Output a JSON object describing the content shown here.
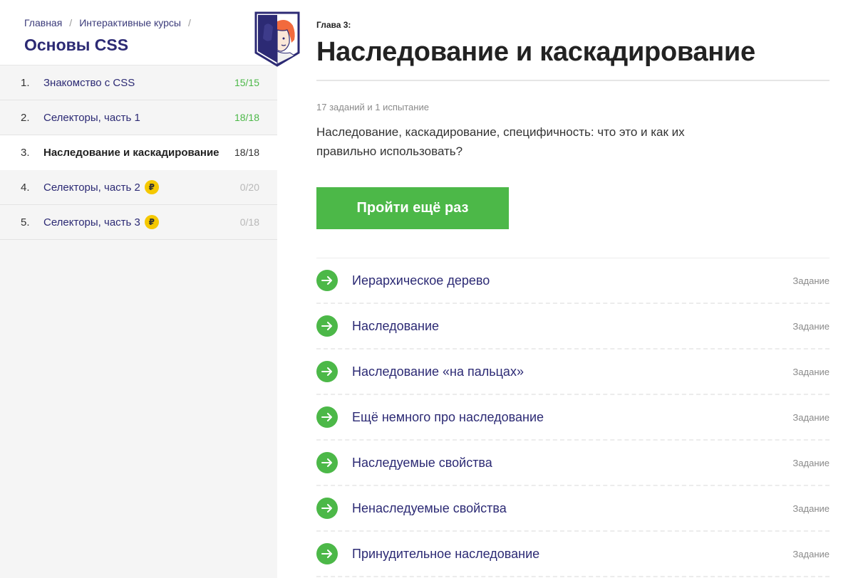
{
  "breadcrumb": {
    "home": "Главная",
    "separator": "/",
    "courses": "Интерактивные курсы"
  },
  "course": {
    "title": "Основы CSS"
  },
  "chapters": [
    {
      "num": "1.",
      "label": "Знакомство с CSS",
      "count": "15/15",
      "status": "done",
      "paid": false
    },
    {
      "num": "2.",
      "label": "Селекторы, часть 1",
      "count": "18/18",
      "status": "done",
      "paid": false
    },
    {
      "num": "3.",
      "label": "Наследование и каскадирование",
      "count": "18/18",
      "status": "current",
      "paid": false
    },
    {
      "num": "4.",
      "label": "Селекторы, часть 2",
      "count": "0/20",
      "status": "locked",
      "paid": true
    },
    {
      "num": "5.",
      "label": "Селекторы, часть 3",
      "count": "0/18",
      "status": "locked",
      "paid": true
    }
  ],
  "paid_badge": "₽",
  "main": {
    "chapter_num": "Глава 3:",
    "title": "Наследование и каскадирование",
    "task_count": "17 заданий и 1 испытание",
    "description": "Наследование, каскадирование, специфичность: что это и как их правильно использовать?",
    "retry_label": "Пройти ещё раз"
  },
  "tasks": [
    {
      "name": "Иерархическое дерево",
      "type": "Задание"
    },
    {
      "name": "Наследование",
      "type": "Задание"
    },
    {
      "name": "Наследование «на пальцах»",
      "type": "Задание"
    },
    {
      "name": "Ещё немного про наследование",
      "type": "Задание"
    },
    {
      "name": "Наследуемые свойства",
      "type": "Задание"
    },
    {
      "name": "Ненаследуемые свойства",
      "type": "Задание"
    },
    {
      "name": "Принудительное наследование",
      "type": "Задание"
    }
  ],
  "colors": {
    "accent_green": "#4cb848",
    "brand_navy": "#2c2a74",
    "coin_yellow": "#f5c800"
  }
}
